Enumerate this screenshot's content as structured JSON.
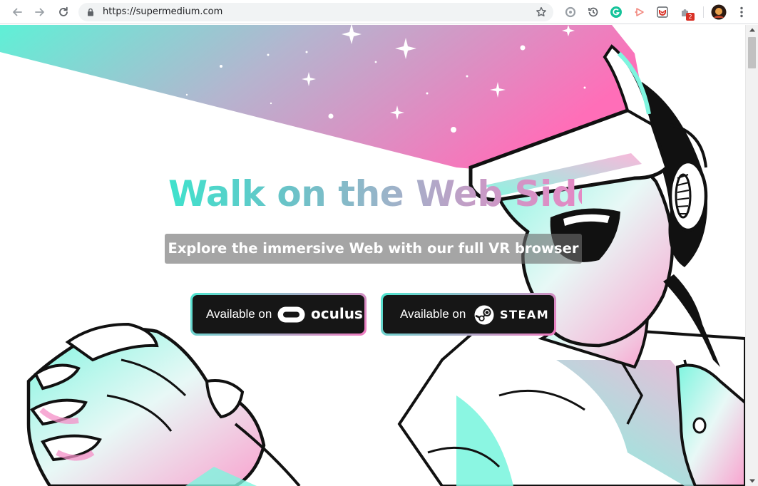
{
  "browser": {
    "url": "https://supermedium.com",
    "extension_badge": "2"
  },
  "icons": {
    "back": "arrow-left-icon",
    "forward": "arrow-right-icon",
    "reload": "reload-icon",
    "lock": "lock-icon",
    "bookmark": "star-icon",
    "menu": "kebab-menu-icon"
  },
  "hero": {
    "headline": "Walk on the Web Side",
    "subtitle": "Explore the immersive Web with our full VR browser"
  },
  "buttons": {
    "oculus": {
      "prefix": "Available on",
      "brand": "oculus"
    },
    "steam": {
      "prefix": "Available on",
      "brand": "STEAM"
    }
  },
  "colors": {
    "gradient_start": "#3fe2cc",
    "gradient_end": "#f472b6",
    "button_background": "#161616"
  }
}
